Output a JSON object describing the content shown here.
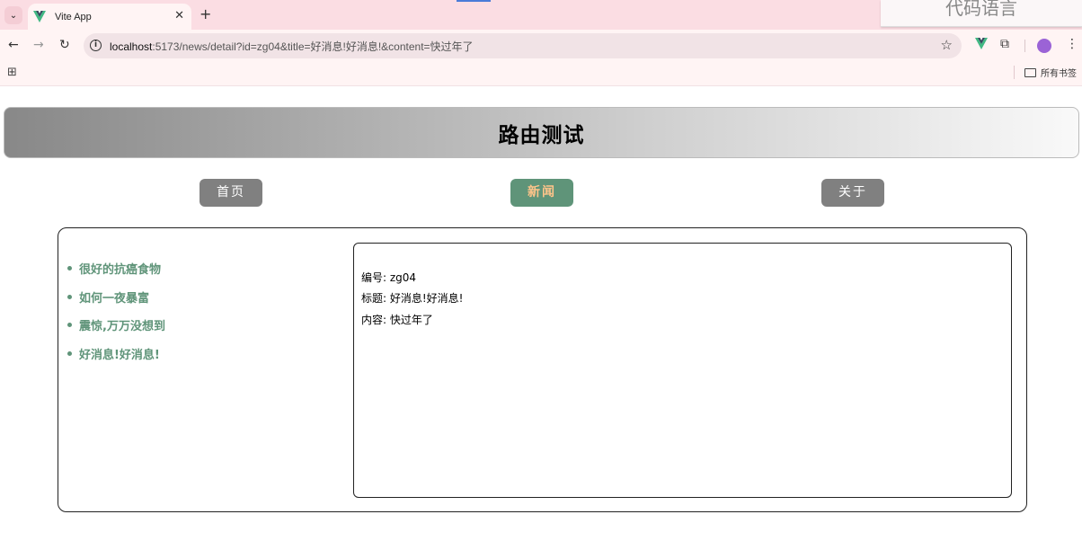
{
  "browser": {
    "tab_title": "Vite App",
    "url_host": "localhost",
    "url_rest": ":5173/news/detail?id=zg04&title=好消息!好消息!&content=快过年了",
    "bookmarks_all": "所有书签",
    "watermark": "代码语言"
  },
  "page": {
    "title": "路由测试",
    "nav": [
      {
        "label": "首页",
        "active": false
      },
      {
        "label": "新闻",
        "active": true
      },
      {
        "label": "关于",
        "active": false
      }
    ],
    "news_list": [
      "很好的抗癌食物",
      "如何一夜暴富",
      "震惊,万万没想到",
      "好消息!好消息!"
    ],
    "detail": {
      "id_line": "编号: zg04",
      "title_line": "标题: 好消息!好消息!",
      "content_line": "内容: 快过年了"
    }
  },
  "colors": {
    "tabbar": "#fbdde3",
    "nav_default": "#808080",
    "nav_active": "#5f9479",
    "nav_active_text": "#ffc48a",
    "link": "#5f9479"
  },
  "icons": [
    "chevron-down-icon",
    "vue-logo-icon",
    "close-icon",
    "plus-icon",
    "back-arrow-icon",
    "forward-arrow-icon",
    "reload-icon",
    "info-icon",
    "star-icon",
    "puzzle-icon",
    "profile-icon",
    "menu-icon",
    "apps-icon",
    "folder-icon"
  ]
}
